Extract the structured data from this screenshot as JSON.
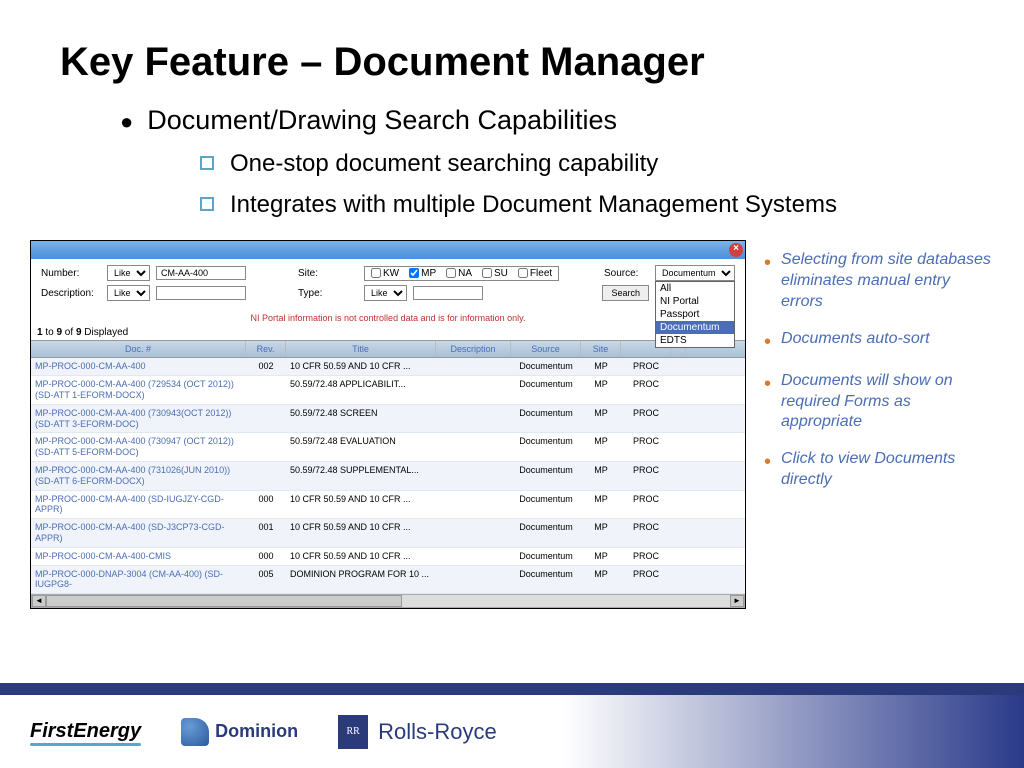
{
  "title": "Key Feature – Document Manager",
  "main_bullet": "Document/Drawing Search Capabilities",
  "sub_bullets": [
    "One-stop document searching capability",
    "Integrates with multiple Document Management Systems"
  ],
  "side_bullets": [
    "Selecting from site databases eliminates manual entry errors",
    "Documents auto-sort",
    "Documents will show on required Forms as appropriate",
    "Click to view Documents directly"
  ],
  "search": {
    "number_label": "Number:",
    "description_label": "Description:",
    "site_label": "Site:",
    "type_label": "Type:",
    "source_label": "Source:",
    "like": "Like",
    "number_value": "CM-AA-400",
    "checkboxes": [
      "KW",
      "MP",
      "NA",
      "SU",
      "Fleet"
    ],
    "checked": "MP",
    "source_value": "Documentum",
    "dropdown_options": [
      "All",
      "NI Portal",
      "Passport",
      "Documentum",
      "EDTS"
    ],
    "dropdown_selected": "Documentum",
    "search_btn": "Search",
    "warning": "NI Portal information is not controlled data and is for information only.",
    "result_count_prefix": "1",
    "result_count_to": " to ",
    "result_count_mid": "9",
    "result_count_of": " of ",
    "result_count_total": "9",
    "result_count_suffix": " Displayed"
  },
  "columns": {
    "doc": "Doc. #",
    "rev": "Rev.",
    "title": "Title",
    "desc": "Description",
    "source": "Source",
    "site": "Site",
    "type": ""
  },
  "rows": [
    {
      "doc": "MP-PROC-000-CM-AA-400",
      "rev": "002",
      "title": "10 CFR 50.59 AND 10 CFR ...",
      "desc": "",
      "source": "Documentum",
      "site": "MP",
      "type": "PROC"
    },
    {
      "doc": "MP-PROC-000-CM-AA-400 (729534 (OCT 2012)) (SD-ATT 1-EFORM-DOCX)",
      "rev": "",
      "title": "50.59/72.48 APPLICABILIT...",
      "desc": "",
      "source": "Documentum",
      "site": "MP",
      "type": "PROC"
    },
    {
      "doc": "MP-PROC-000-CM-AA-400 (730943(OCT 2012)) (SD-ATT 3-EFORM-DOC)",
      "rev": "",
      "title": "50.59/72.48 SCREEN",
      "desc": "",
      "source": "Documentum",
      "site": "MP",
      "type": "PROC"
    },
    {
      "doc": "MP-PROC-000-CM-AA-400 (730947 (OCT 2012)) (SD-ATT 5-EFORM-DOC)",
      "rev": "",
      "title": "50.59/72.48 EVALUATION",
      "desc": "",
      "source": "Documentum",
      "site": "MP",
      "type": "PROC"
    },
    {
      "doc": "MP-PROC-000-CM-AA-400 (731026(JUN 2010)) (SD-ATT 6-EFORM-DOCX)",
      "rev": "",
      "title": "50.59/72.48 SUPPLEMENTAL...",
      "desc": "",
      "source": "Documentum",
      "site": "MP",
      "type": "PROC"
    },
    {
      "doc": "MP-PROC-000-CM-AA-400 (SD-IUGJZY-CGD-APPR)",
      "rev": "000",
      "title": "10 CFR 50.59 AND 10 CFR ...",
      "desc": "",
      "source": "Documentum",
      "site": "MP",
      "type": "PROC"
    },
    {
      "doc": "MP-PROC-000-CM-AA-400 (SD-J3CP73-CGD-APPR)",
      "rev": "001",
      "title": "10 CFR 50.59 AND 10 CFR ...",
      "desc": "",
      "source": "Documentum",
      "site": "MP",
      "type": "PROC"
    },
    {
      "doc": "MP-PROC-000-CM-AA-400-CMIS",
      "rev": "000",
      "title": "10 CFR 50.59 AND 10 CFR ...",
      "desc": "",
      "source": "Documentum",
      "site": "MP",
      "type": "PROC"
    },
    {
      "doc": "MP-PROC-000-DNAP-3004 (CM-AA-400) (SD-IUGPG8-",
      "rev": "005",
      "title": "DOMINION PROGRAM FOR 10 ...",
      "desc": "",
      "source": "Documentum",
      "site": "MP",
      "type": "PROC"
    }
  ],
  "logos": {
    "fe": "FirstEnergy",
    "dom": "Dominion",
    "rr": "Rolls-Royce",
    "rr_badge": "RR"
  }
}
